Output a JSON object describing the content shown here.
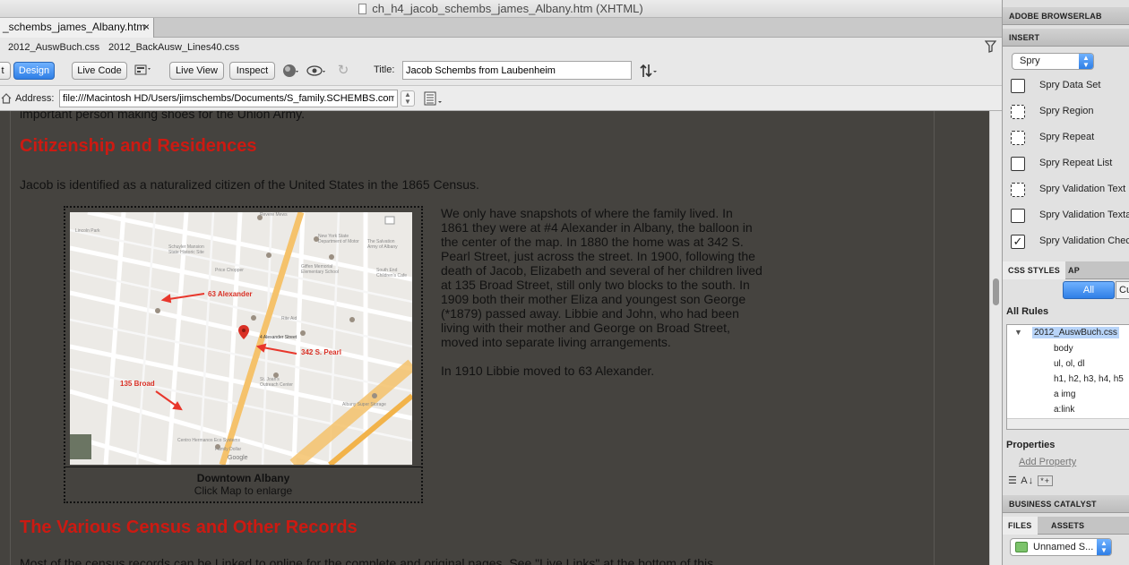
{
  "window": {
    "title": "ch_h4_jacob_schembs_james_Albany.htm (XHTML)"
  },
  "doc_tab": {
    "label": "_schembs_james_Albany.htm",
    "close": "×"
  },
  "related_files": [
    "2012_AuswBuch.css",
    "2012_BackAusw_Lines40.css"
  ],
  "toolbar": {
    "code_label": "t",
    "design_label": "Design",
    "live_code_label": "Live Code",
    "live_view_label": "Live View",
    "inspect_label": "Inspect",
    "title_label": "Title:",
    "title_value": "Jacob Schembs from Laubenheim"
  },
  "address": {
    "label": "Address:",
    "value": "file:///Macintosh HD/Users/jimschembs/Documents/S_family.SCHEMBS.com"
  },
  "page": {
    "top_fragment": "important person making shoes for the Union Army.",
    "heading1": "Citizenship and Residences",
    "para1": "Jacob is identified as a naturalized citizen of the United States in the 1865 Census.",
    "figure_caption_title": "Downtown Albany",
    "figure_caption_sub": "Click Map to enlarge",
    "text_col_1": "We only have snapshots of where the family lived. In 1861 they were at #4 Alexander in Albany, the balloon in the center of the map. In 1880 the home was at 342 S. Pearl Street, just across the street. In 1900, following the death of Jacob, Elizabeth and several of her children lived at 135 Broad Street, still only two blocks to the south. In 1909 both their mother Eliza and youngest son George (*1879) passed away. Libbie and John, who had been living with their mother and George on Broad Street, moved into separate living arrangements.",
    "text_col_2": "In 1910 Libbie moved to 63 Alexander.",
    "heading2": "The Various Census and Other Records",
    "bottom_fragment": "Most of the census records can be Linked to online for the complete and original pages. See \"Live Links\" at the bottom of this"
  },
  "map": {
    "labels": {
      "alexander": "63 Alexander",
      "pearl": "342 S. Pearl",
      "broad": "135 Broad",
      "street_4": "4 Alexander Street"
    },
    "places": [
      "Revere Mews",
      "New York State Department of Motor",
      "The Salvation Army of Albany",
      "Schuyler Mansion State Historic Site",
      "Giffen Memorial Elementary School",
      "South End Children's Cafe",
      "Price Chopper",
      "Lincoln Park",
      "Rite Aid",
      "Albany Super Storage",
      "St. Joan's Outreach Center",
      "Centro Hermanos Eco Systems",
      "Family Dollar"
    ],
    "colors": {
      "arrow": "#e8372c",
      "label": "#d93025",
      "road": "#f5c26b",
      "pin": "#d93025"
    }
  },
  "panel": {
    "browserlab": "ADOBE BROWSERLAB",
    "insert": "INSERT",
    "insert_category": "Spry",
    "spry_items": [
      "Spry Data Set",
      "Spry Region",
      "Spry Repeat",
      "Spry Repeat List",
      "Spry Validation Text",
      "Spry Validation Texta",
      "Spry Validation Chec"
    ],
    "css_styles_tab": "CSS STYLES",
    "ap_elements_tab": "AP ELEMENTS",
    "all_btn": "All",
    "current_btn": "Cu",
    "all_rules": "All Rules",
    "stylesheet": "2012_AuswBuch.css",
    "rules": [
      "body",
      "ul, ol, dl",
      "h1, h2, h3, h4, h5",
      "a img",
      "a:link"
    ],
    "properties": "Properties",
    "add_property": "Add Property",
    "business_catalyst": "BUSINESS CATALYST",
    "files_tab": "FILES",
    "assets_tab": "ASSETS",
    "site_select": "Unnamed S..."
  }
}
